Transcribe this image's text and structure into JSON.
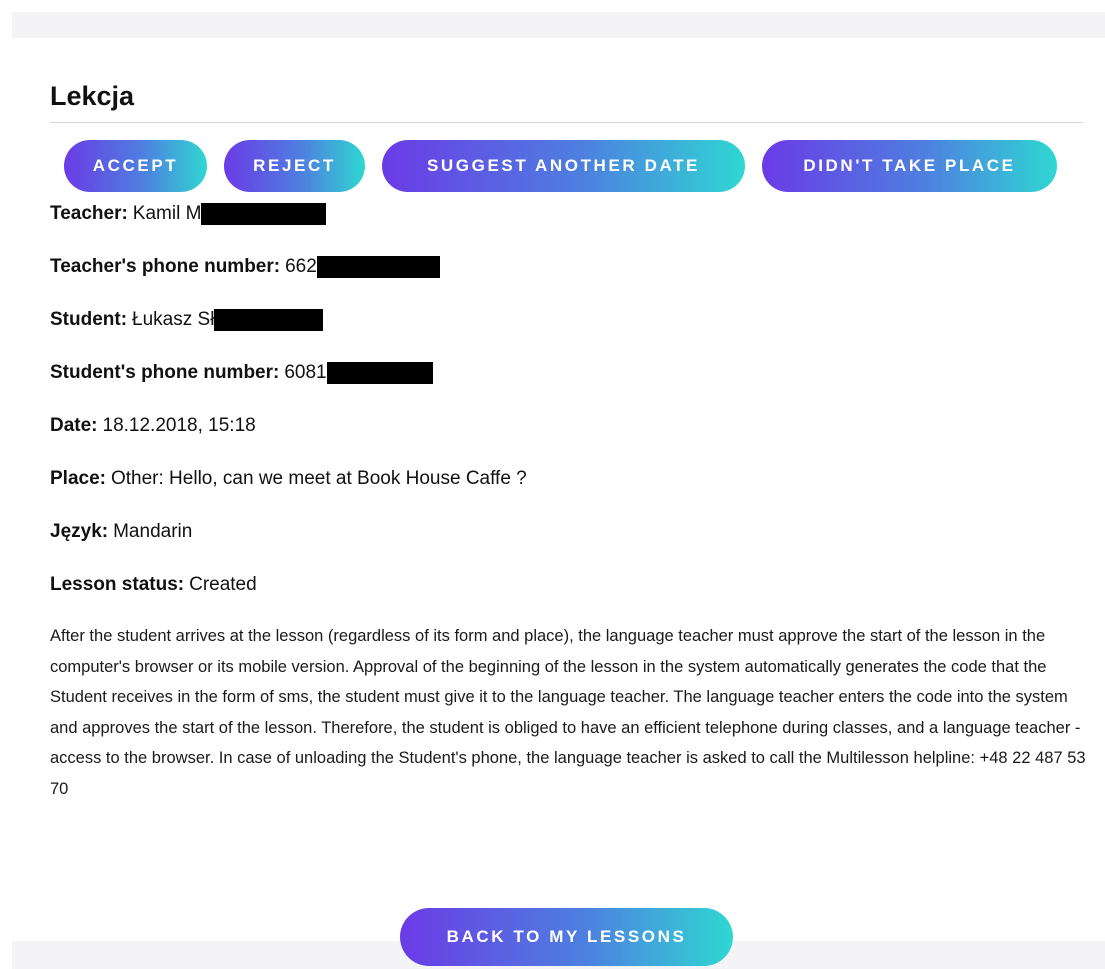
{
  "page": {
    "title": "Lekcja"
  },
  "actions": {
    "accept": "ACCEPT",
    "reject": "REJECT",
    "suggest": "SUGGEST ANOTHER DATE",
    "didnt_take_place": "DIDN'T TAKE PLACE"
  },
  "lesson": {
    "teacher_label": "Teacher:",
    "teacher_value": "Kamil M",
    "teacher_phone_label": "Teacher's phone number:",
    "teacher_phone_value": "662",
    "student_label": "Student:",
    "student_value": "Łukasz Sł",
    "student_phone_label": "Student's phone number:",
    "student_phone_value": "6081",
    "date_label": "Date:",
    "date_value": "18.12.2018, 15:18",
    "place_label": "Place:",
    "place_value": "Other: Hello, can we meet at Book House Caffe ?",
    "language_label": "Język:",
    "language_value": "Mandarin",
    "status_label": "Lesson status:",
    "status_value": "Created"
  },
  "notice": {
    "text": "After the student arrives at the lesson (regardless of its form and place), the language teacher must approve the start of the lesson in the computer's browser or its mobile version. Approval of the beginning of the lesson in the system automatically generates the code that the Student receives in the form of sms, the student must give it to the language teacher. The language teacher enters the code into the system and approves the start of the lesson. Therefore, the student is obliged to have an efficient telephone during classes, and a language teacher - access to the browser. In case of unloading the Student's phone, the language teacher is asked to call the Multilesson helpline: +48 22 487 53 70"
  },
  "footer": {
    "back_label": "BACK TO MY LESSONS"
  },
  "colors": {
    "button_gradient_start": "#6a3be6",
    "button_gradient_mid": "#4e7fe0",
    "button_gradient_end": "#2fd7d2",
    "redaction": "#000000"
  }
}
